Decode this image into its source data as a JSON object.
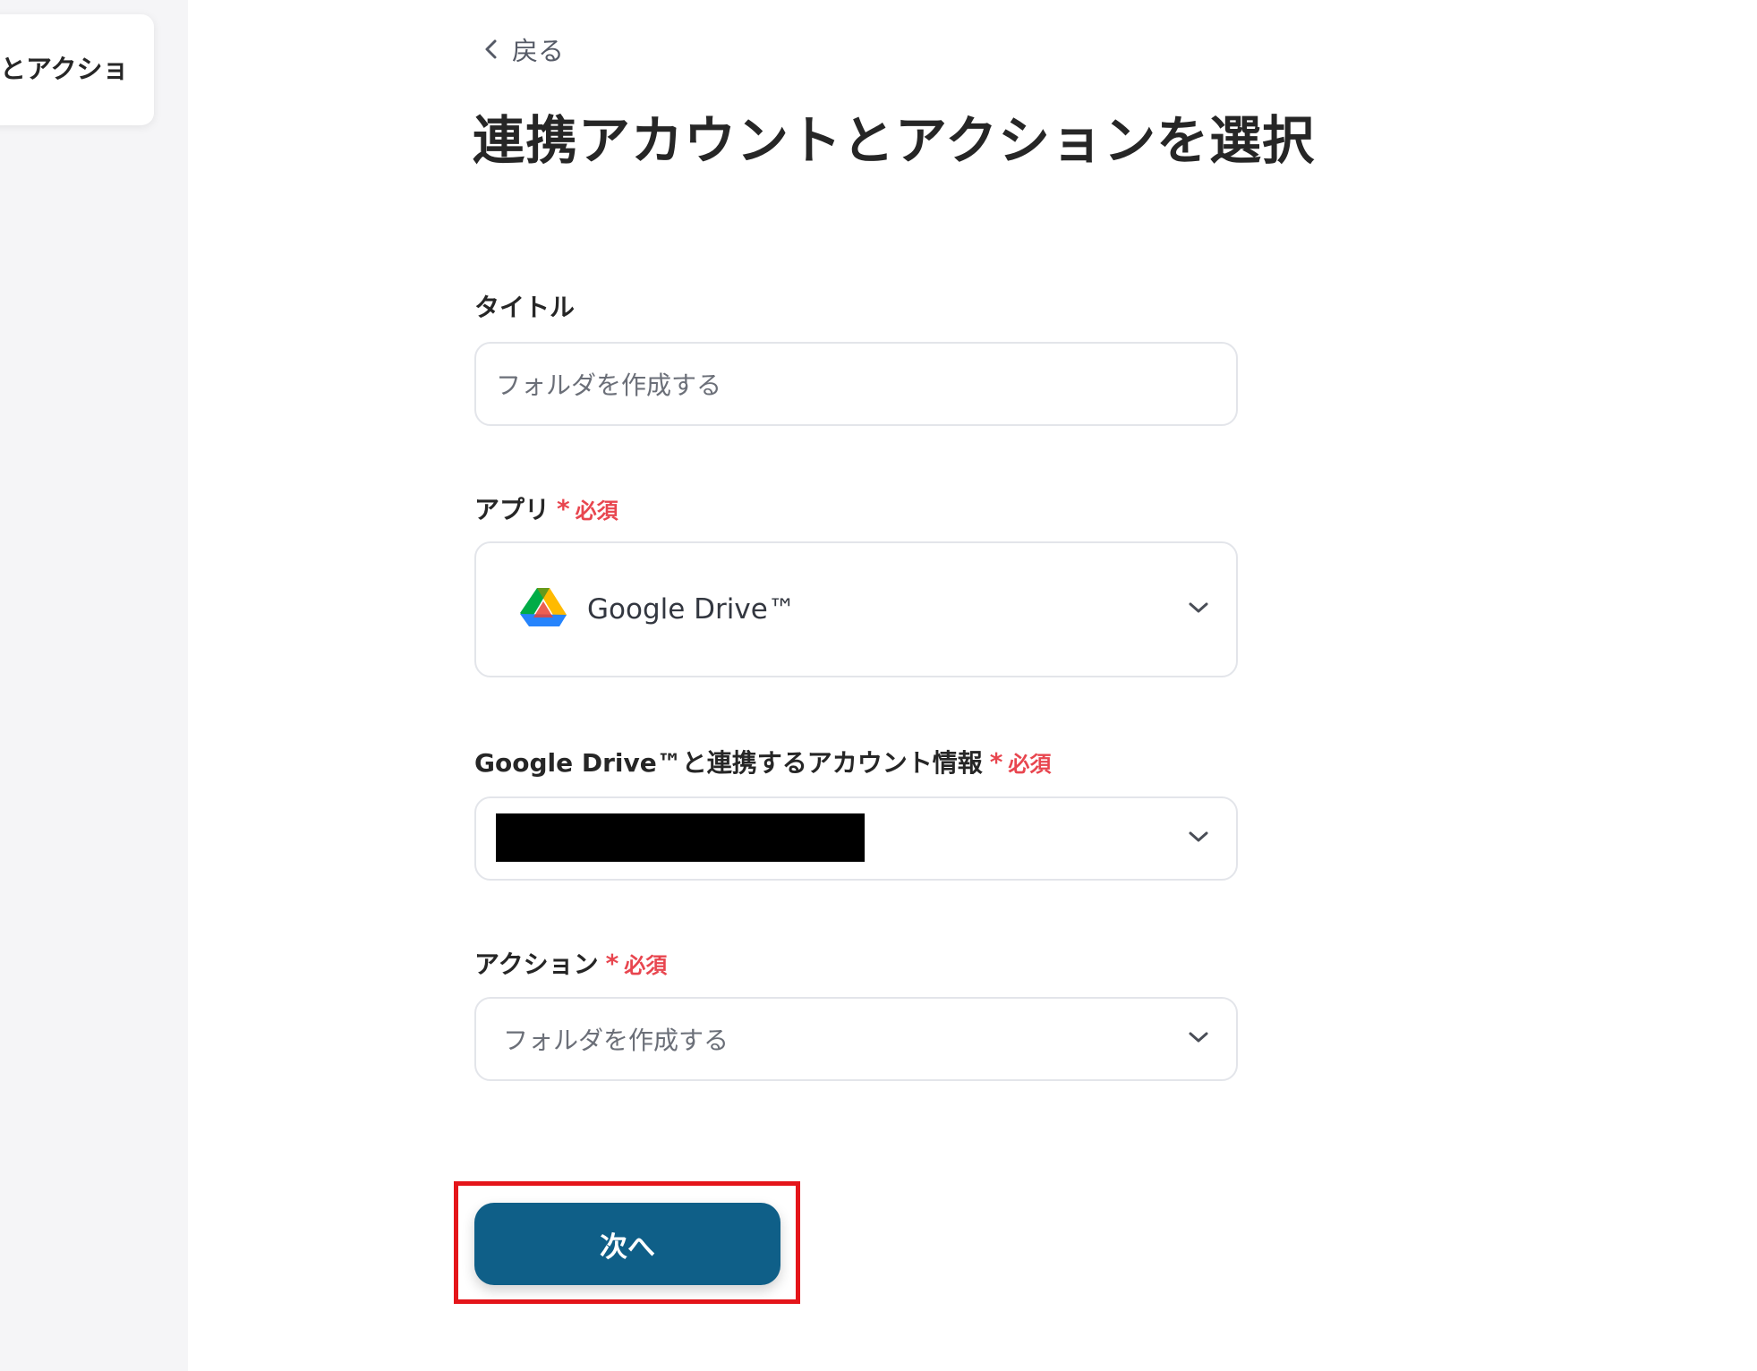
{
  "sidebar": {
    "card_text": "とアクショ"
  },
  "header": {
    "back_label": "戻る",
    "title": "連携アカウントとアクションを選択"
  },
  "form": {
    "title_field": {
      "label": "タイトル",
      "value": "フォルダを作成する"
    },
    "app_field": {
      "label": "アプリ",
      "required_label": "必須",
      "value": "Google Drive™",
      "icon": "google-drive-icon"
    },
    "account_field": {
      "label": "Google Drive™と連携するアカウント情報",
      "required_label": "必須",
      "value_redacted": true
    },
    "action_field": {
      "label": "アクション",
      "required_label": "必須",
      "value": "フォルダを作成する"
    }
  },
  "footer": {
    "next_label": "次へ"
  },
  "colors": {
    "primary_button": "#0f5f88",
    "required": "#e8464f",
    "highlight_border": "#e4151a",
    "sidebar_bg": "#f5f5f7"
  }
}
